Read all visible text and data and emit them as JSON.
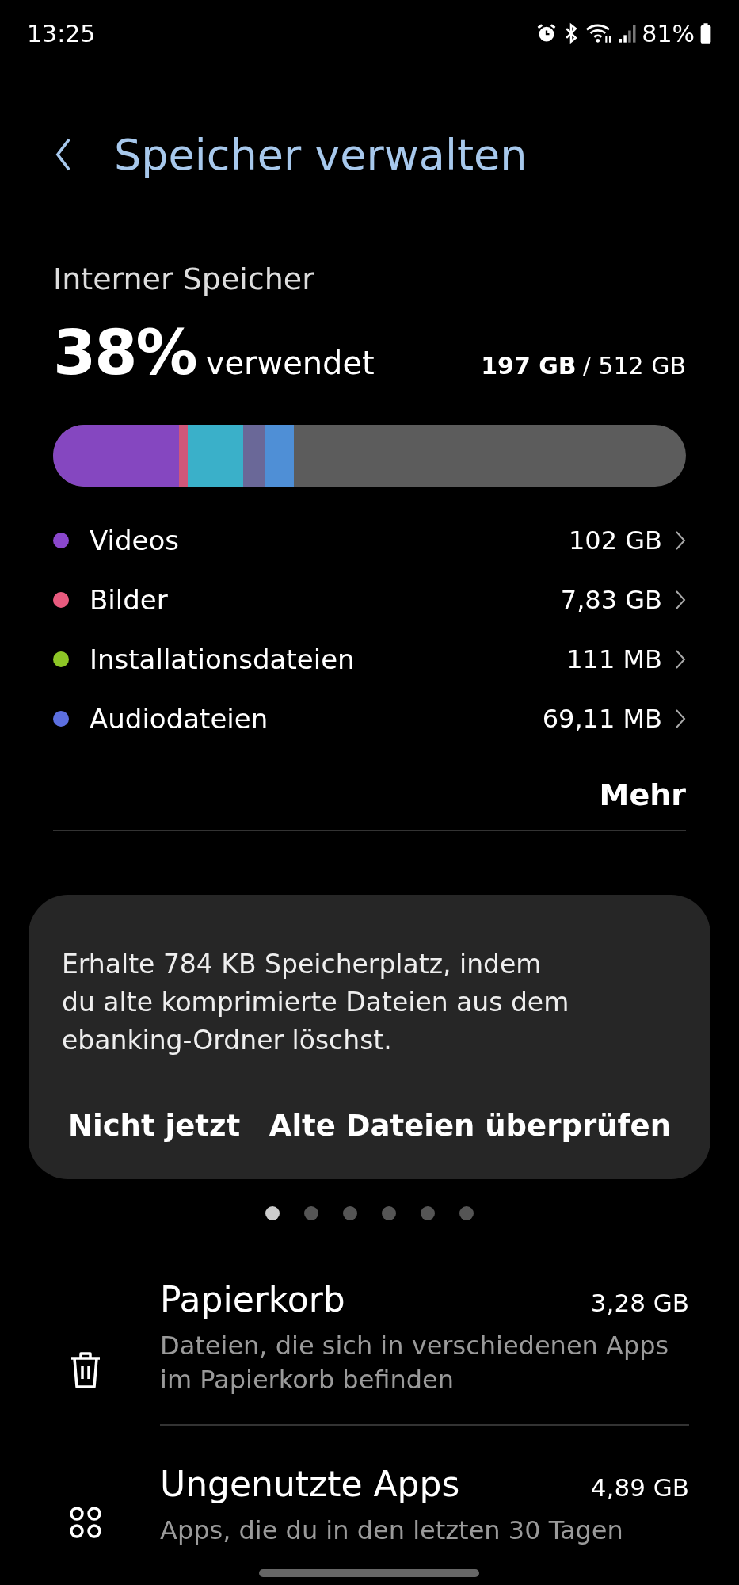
{
  "status_bar": {
    "time": "13:25",
    "battery": "81%"
  },
  "header": {
    "title": "Speicher verwalten"
  },
  "storage": {
    "label": "Interner Speicher",
    "percent": "38%",
    "used_label": "verwendet",
    "used": "197 GB",
    "total": "/ 512 GB",
    "bar_segments": [
      {
        "color": "#8547c0"
      },
      {
        "color": "#d0577a"
      },
      {
        "color": "#3ab0c9"
      },
      {
        "color": "#6a6898"
      },
      {
        "color": "#4f8fd6"
      }
    ],
    "categories": [
      {
        "name": "Videos",
        "size": "102 GB",
        "color": "#8a47cc"
      },
      {
        "name": "Bilder",
        "size": "7,83 GB",
        "color": "#e85a7e"
      },
      {
        "name": "Installationsdateien",
        "size": "111 MB",
        "color": "#8dc626"
      },
      {
        "name": "Audiodateien",
        "size": "69,11 MB",
        "color": "#5c6fe0"
      }
    ],
    "more": "Mehr"
  },
  "suggestion_card": {
    "text": "Erhalte 784 KB Speicherplatz, indem du alte komprimierte Dateien aus dem ebanking-Ordner löschst.",
    "buttons": [
      "Nicht jetzt",
      "Alte Dateien überprüfen"
    ]
  },
  "pager": [
    {
      "selected": true
    },
    {
      "selected": false
    },
    {
      "selected": false
    },
    {
      "selected": false
    },
    {
      "selected": false
    },
    {
      "selected": false
    }
  ],
  "items": [
    {
      "kind": "trash",
      "title": "Papierkorb",
      "size": "3,28 GB",
      "subtitle": "Dateien, die sich in verschiedenen Apps im Papierkorb befinden"
    },
    {
      "kind": "apps",
      "title": "Ungenutzte Apps",
      "size": "4,89 GB",
      "subtitle": "Apps, die du in den letzten 30 Tagen"
    }
  ]
}
